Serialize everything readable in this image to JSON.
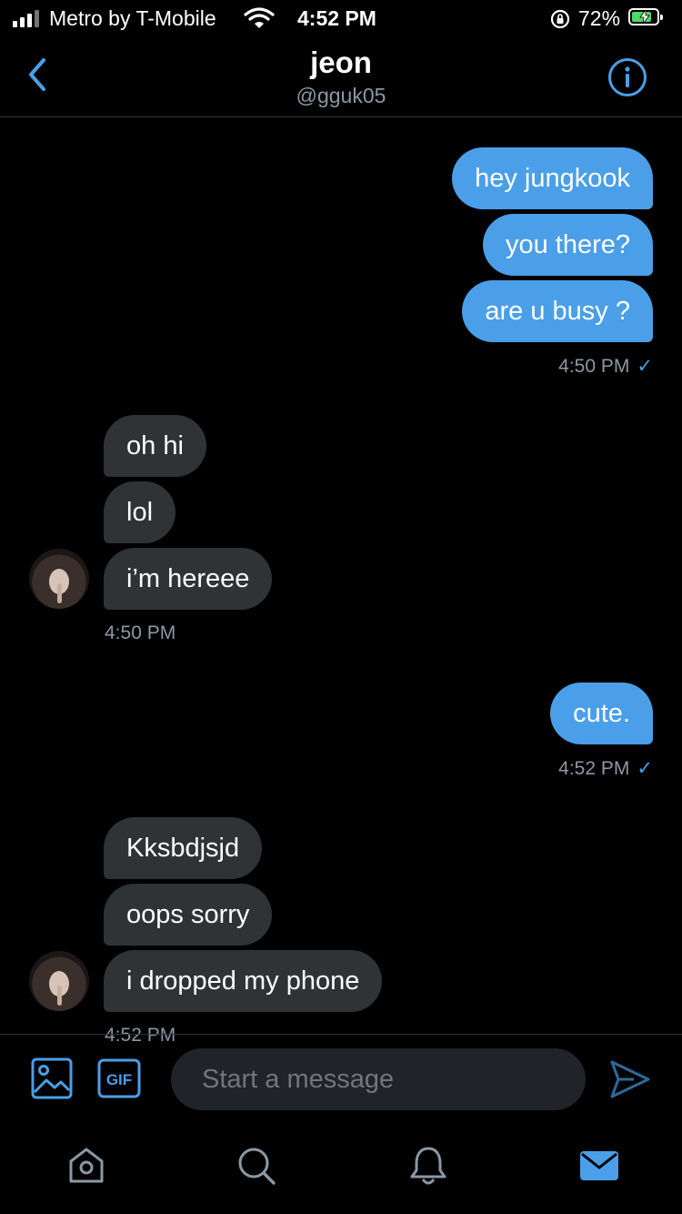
{
  "status_bar": {
    "carrier": "Metro by T-Mobile",
    "time": "4:52 PM",
    "battery_percent": "72%",
    "icons": [
      "signal-icon",
      "wifi-icon",
      "orientation-lock-icon",
      "battery-charging-icon"
    ]
  },
  "header": {
    "name": "jeon",
    "handle": "@gguk05",
    "back_icon": "chevron-left-icon",
    "info_icon": "info-icon"
  },
  "conversation": [
    {
      "direction": "out",
      "messages": [
        "hey jungkook",
        "you there?",
        "are u busy ?"
      ],
      "time": "4:50 PM",
      "read": "✓"
    },
    {
      "direction": "in",
      "messages": [
        "oh hi",
        "lol",
        "i’m hereee"
      ],
      "time": "4:50 PM"
    },
    {
      "direction": "out",
      "messages": [
        "cute."
      ],
      "time": "4:52 PM",
      "read": "✓"
    },
    {
      "direction": "in",
      "messages": [
        "Kksbdjsjd",
        "oops sorry",
        "i dropped my phone"
      ],
      "time": "4:52 PM"
    }
  ],
  "composer": {
    "placeholder": "Start a message",
    "gif_label": "GIF",
    "icons": [
      "image-icon",
      "gif-icon",
      "send-icon"
    ]
  },
  "tab_bar": {
    "items": [
      "home-icon",
      "search-icon",
      "notifications-icon",
      "messages-icon"
    ],
    "active": "messages-icon"
  },
  "colors": {
    "background": "#000000",
    "accent": "#4a9fe8",
    "incoming_bubble": "#2f3336",
    "muted_text": "#8b98a5"
  }
}
